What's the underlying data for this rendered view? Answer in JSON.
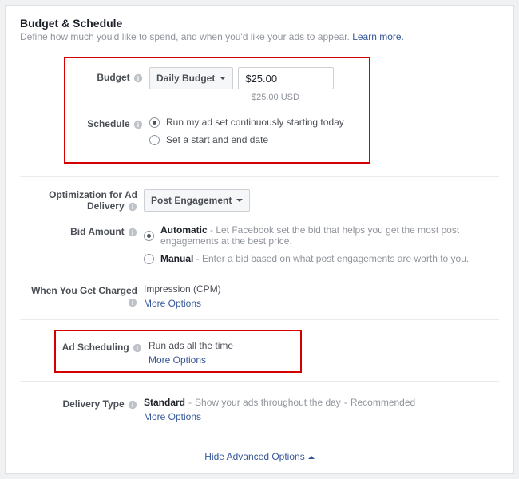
{
  "header": {
    "title": "Budget & Schedule",
    "subtitle": "Define how much you'd like to spend, and when you'd like your ads to appear. ",
    "learn_more": "Learn more."
  },
  "budget": {
    "label": "Budget",
    "dropdown_value": "Daily Budget",
    "amount": "$25.00",
    "helper": "$25.00 USD"
  },
  "schedule": {
    "label": "Schedule",
    "option_continuous": "Run my ad set continuously starting today",
    "option_dates": "Set a start and end date"
  },
  "optimization": {
    "label": "Optimization for Ad Delivery",
    "dropdown_value": "Post Engagement"
  },
  "bid": {
    "label": "Bid Amount",
    "auto_bold": "Automatic",
    "auto_desc": " - Let Facebook set the bid that helps you get the most post engagements at the best price.",
    "manual_bold": "Manual",
    "manual_desc": " - Enter a bid based on what post engagements are worth to you."
  },
  "charge": {
    "label": "When You Get Charged",
    "value": "Impression (CPM)",
    "more": "More Options"
  },
  "ad_scheduling": {
    "label": "Ad Scheduling",
    "value": "Run ads all the time",
    "more": "More Options"
  },
  "delivery": {
    "label": "Delivery Type",
    "value_bold": "Standard",
    "value_desc": "Show your ads throughout the day",
    "value_rec": "Recommended",
    "more": "More Options"
  },
  "footer": {
    "hide_advanced": "Hide Advanced Options"
  }
}
